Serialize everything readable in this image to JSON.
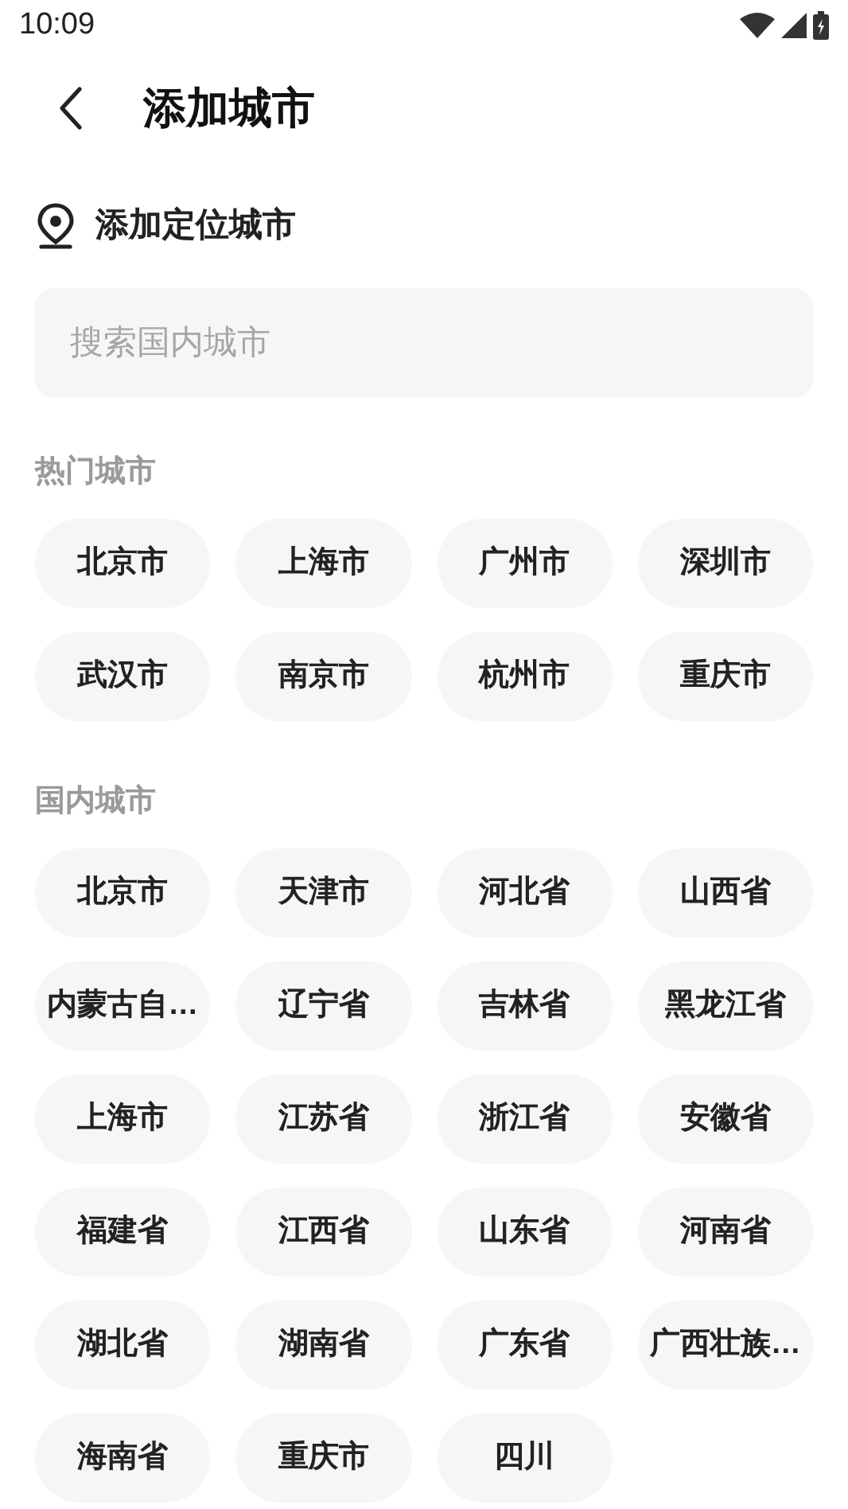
{
  "status_bar": {
    "time": "10:09"
  },
  "header": {
    "title": "添加城市"
  },
  "locate": {
    "label": "添加定位城市"
  },
  "search": {
    "placeholder": "搜索国内城市"
  },
  "sections": [
    {
      "title": "热门城市",
      "cities": [
        "北京市",
        "上海市",
        "广州市",
        "深圳市",
        "武汉市",
        "南京市",
        "杭州市",
        "重庆市"
      ]
    },
    {
      "title": "国内城市",
      "cities": [
        "北京市",
        "天津市",
        "河北省",
        "山西省",
        "内蒙古自…",
        "辽宁省",
        "吉林省",
        "黑龙江省",
        "上海市",
        "江苏省",
        "浙江省",
        "安徽省",
        "福建省",
        "江西省",
        "山东省",
        "河南省",
        "湖北省",
        "湖南省",
        "广东省",
        "广西壮族…",
        "海南省",
        "重庆市",
        "四川"
      ]
    }
  ]
}
